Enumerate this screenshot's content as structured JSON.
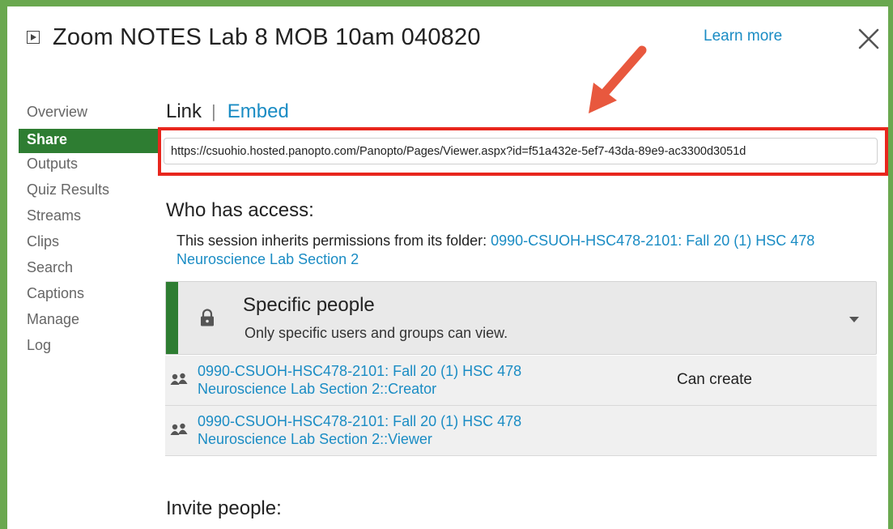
{
  "header": {
    "title": "Zoom NOTES Lab 8 MOB 10am 040820",
    "learn_more": "Learn more"
  },
  "sidebar": {
    "items": [
      {
        "label": "Overview"
      },
      {
        "label": "Share"
      },
      {
        "label": "Outputs"
      },
      {
        "label": "Quiz Results"
      },
      {
        "label": "Streams"
      },
      {
        "label": "Clips"
      },
      {
        "label": "Search"
      },
      {
        "label": "Captions"
      },
      {
        "label": "Manage"
      },
      {
        "label": "Log"
      }
    ],
    "active": "Share"
  },
  "share": {
    "tab_link": "Link",
    "tab_separator": "|",
    "tab_embed": "Embed",
    "url": "https://csuohio.hosted.panopto.com/Panopto/Pages/Viewer.aspx?id=f51a432e-5ef7-43da-89e9-ac3300d3051d",
    "who_heading": "Who has access:",
    "inherit_prefix": "This session inherits permissions from its folder: ",
    "inherit_folder": "0990-CSUOH-HSC478-2101: Fall 20 (1) HSC 478 Neuroscience Lab Section 2",
    "access_level": {
      "title": "Specific people",
      "subtitle": "Only specific users and groups can view."
    },
    "permissions": [
      {
        "name_line1": "0990-CSUOH-HSC478-2101: Fall 20 (1) HSC 478",
        "name_line2": "Neuroscience Lab Section 2::Creator",
        "role": "Can create"
      },
      {
        "name_line1": "0990-CSUOH-HSC478-2101: Fall 20 (1) HSC 478",
        "name_line2": "Neuroscience Lab Section 2::Viewer",
        "role": ""
      }
    ],
    "invite_heading": "Invite people:"
  },
  "colors": {
    "frame": "#6aa84f",
    "active_nav": "#2e7d32",
    "link": "#1a8cc4",
    "highlight": "#e8261d"
  },
  "icons": {
    "play": "play-icon",
    "close": "close-icon",
    "lock": "lock-icon",
    "group": "group-icon",
    "caret": "chevron-down-icon",
    "arrow": "annotation-arrow"
  }
}
